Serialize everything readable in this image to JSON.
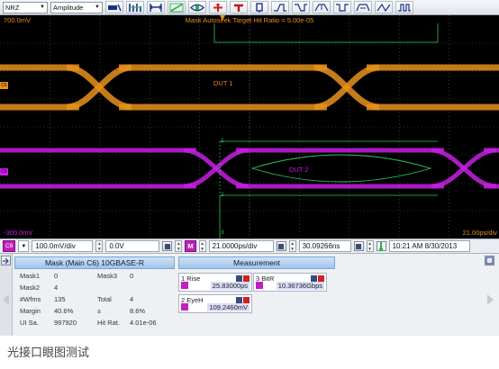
{
  "toolbar": {
    "format_select": "NRZ",
    "mode_select": "Amplitude"
  },
  "scope": {
    "mask_status": "Mask Autoseek Target Hit Ratio = 5.00e-05",
    "top_left_scale": "700.0mV",
    "bottom_left_scale": "-300.0mV",
    "bottom_right_scale": "21.00ps/div",
    "marker_1": "1",
    "marker_2": "2",
    "marker_3": "3",
    "dut1_label": "DUT 1",
    "dut2_label": "DUT 2",
    "ch_marker_upper": "C6",
    "ch_marker_lower": "C6",
    "colors": {
      "upper_trace": "#e8901c",
      "lower_trace": "#c81ee6",
      "mask": "#2ec85a",
      "grid": "#5a5a5a"
    }
  },
  "scalebar": {
    "channel": "C6",
    "vertical_scale": "100.0mV/div",
    "offset": "0.0V",
    "m_button": "M",
    "time_scale": "21.0000ps/div",
    "time_position": "30.09266ns",
    "timestamp": "10:21 AM 8/30/2013"
  },
  "mask_panel": {
    "title": "Mask (Main  C6) 10GBASE-R",
    "mask1_label": "Mask1",
    "mask1_value": "0",
    "mask3_label": "Mask3",
    "mask3_value": "0",
    "mask2_label": "Mask2",
    "mask2_value": "4",
    "wfms_label": "#Wfms",
    "wfms_value": "135",
    "total_label": "Total",
    "total_value": "4",
    "margin_label": "Margin",
    "margin_value": "40.6%",
    "pm_label": "±",
    "pm_value": "8.6%",
    "ui_label": "UI Sa.",
    "ui_value": "997920",
    "hit_label": "Hit Rat.",
    "hit_value": "4.01e-06"
  },
  "measurement_panel": {
    "title": "Measurement",
    "rise_label": "1 Rise",
    "rise_value": "25.83000ps",
    "bitr_label": "3 BitR",
    "bitr_value": "10.36736Gbps",
    "eyeh_label": "2 EyeH",
    "eyeh_value": "109.2460mV"
  },
  "caption": "光接口眼图测试"
}
